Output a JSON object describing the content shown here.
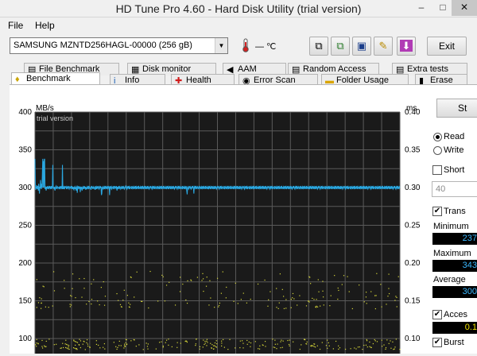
{
  "window": {
    "title": "HD Tune Pro 4.60 - Hard Disk Utility (trial version)",
    "minimize": "–",
    "maximize": "□",
    "close": "✕"
  },
  "menu": {
    "file": "File",
    "help": "Help"
  },
  "toolbar": {
    "drive": "SAMSUNG MZNTD256HAGL-00000 (256 gB)",
    "temperature": "— ℃",
    "exit_label": "Exit",
    "buttons": [
      "copy-info-icon",
      "copy-screenshot-icon",
      "save-icon",
      "options-icon",
      "download-icon"
    ]
  },
  "tabs_row1": [
    "File Benchmark",
    "Disk monitor",
    "AAM",
    "Random Access",
    "Extra tests"
  ],
  "tabs_row2": [
    "Benchmark",
    "Info",
    "Health",
    "Error Scan",
    "Folder Usage",
    "Erase"
  ],
  "side": {
    "start_label": "St",
    "read_label": "Read",
    "write_label": "Write",
    "short_label": "Short",
    "short_value": "40",
    "transfer_label": "Trans",
    "minimum_label": "Minimum",
    "minimum_value": "237",
    "maximum_label": "Maximum",
    "maximum_value": "343",
    "average_label": "Average",
    "average_value": "300",
    "access_label": "Acces",
    "access_value": "0.1",
    "burst_label": "Burst"
  },
  "chart_data": {
    "type": "line",
    "watermark": "trial version",
    "ylabel_left": "MB/s",
    "ylabel_right": "ms",
    "y_left_ticks": [
      400,
      350,
      300,
      250,
      200,
      150,
      100
    ],
    "y_right_ticks": [
      "0.40",
      "0.35",
      "0.30",
      "0.25",
      "0.20",
      "0.15",
      "0.10"
    ],
    "ylim_left": [
      80,
      400
    ],
    "ylim_right": [
      0.08,
      0.4
    ],
    "grid": true,
    "series": [
      {
        "values": [
          338,
          305,
          297,
          301,
          299,
          303,
          298,
          300,
          302,
          296,
          305,
          300,
          292,
          301,
          299,
          310,
          302,
          298,
          305,
          300,
          320,
          338,
          300,
          335,
          300,
          337,
          338,
          298,
          301,
          300,
          296,
          301,
          299,
          300,
          302,
          298,
          300,
          301,
          299,
          300,
          302,
          299,
          300,
          298,
          302,
          300,
          299,
          301,
          330,
          300,
          300,
          298,
          301,
          298,
          296,
          300,
          301,
          302,
          298,
          300,
          299,
          301,
          300,
          300,
          299,
          301,
          298,
          300,
          302,
          299,
          300,
          301,
          299,
          298,
          330,
          298,
          300,
          301,
          298,
          300,
          299,
          302,
          300,
          300,
          301,
          298,
          300,
          299,
          301,
          300,
          302,
          299,
          298,
          300,
          301,
          300,
          299,
          301,
          300,
          302,
          298,
          300,
          299,
          301,
          298,
          297,
          300,
          301,
          298,
          300,
          299,
          296,
          301,
          300,
          293,
          301,
          300,
          299,
          302,
          300,
          298,
          301,
          294,
          300,
          299,
          301,
          298,
          296,
          300,
          301,
          299,
          300,
          298,
          302,
          300,
          299,
          301,
          297,
          300,
          300,
          298,
          301,
          300,
          299,
          302,
          298,
          301,
          300,
          299,
          300,
          300,
          297,
          302,
          299,
          301,
          300,
          298,
          300,
          301,
          299,
          300,
          300,
          297,
          302,
          299,
          300,
          298,
          301,
          300,
          299,
          302,
          300,
          299,
          298,
          301,
          300,
          302,
          299,
          301,
          290,
          292,
          300,
          301,
          299,
          298,
          300,
          301,
          298,
          300,
          302,
          299,
          300,
          301,
          298,
          300,
          299,
          302,
          300,
          301,
          299,
          300,
          290,
          300,
          302,
          299,
          300,
          301,
          298,
          299,
          300,
          301,
          300,
          298,
          302,
          299,
          300,
          301,
          300,
          299,
          302,
          300,
          296,
          301,
          299,
          300,
          298,
          302,
          300,
          299,
          301,
          300,
          298,
          299,
          301,
          300,
          298,
          302,
          300,
          299,
          301,
          300,
          298,
          299,
          301,
          302,
          300,
          299,
          298,
          301,
          300,
          299,
          302,
          300,
          301,
          298,
          300,
          299,
          301,
          300,
          300,
          298,
          302,
          299,
          300,
          301,
          299,
          300,
          298,
          301,
          300,
          299,
          302,
          300,
          298,
          301,
          300,
          299,
          300,
          302,
          298,
          301,
          300,
          299,
          300,
          301,
          298,
          300,
          299,
          302,
          300,
          301,
          298,
          300,
          299,
          301,
          300,
          302,
          298,
          300,
          301,
          299,
          300,
          298,
          302,
          300,
          299,
          301,
          300,
          298,
          299,
          301,
          300,
          302,
          300,
          299,
          298,
          301,
          300,
          299,
          302,
          300,
          301,
          298,
          300,
          299,
          301,
          300,
          300,
          298,
          302,
          299,
          300,
          301,
          299,
          300,
          298,
          301,
          300,
          299,
          302,
          300,
          298,
          301,
          300,
          299,
          300,
          302,
          298,
          301,
          300,
          299,
          300,
          301,
          298,
          300,
          299,
          302,
          300,
          301,
          298,
          300,
          299,
          301,
          300,
          302,
          298,
          300,
          301,
          299,
          300,
          298,
          302,
          300,
          299,
          301,
          300,
          298,
          299,
          301,
          300,
          302,
          300,
          299,
          298,
          301,
          300,
          299,
          302,
          300,
          301,
          298,
          300,
          299,
          301,
          300,
          300,
          298,
          302,
          299,
          300,
          301,
          299,
          300,
          298,
          301,
          300,
          299,
          302,
          300,
          295,
          291,
          300,
          301,
          299,
          298,
          300,
          302,
          300,
          299,
          301,
          300,
          298,
          299,
          301,
          300,
          302,
          300,
          299,
          292,
          301,
          300,
          299,
          302,
          300,
          301,
          298,
          300,
          299,
          301,
          300,
          300,
          298,
          302,
          299,
          300,
          301,
          299,
          300,
          298,
          301,
          300,
          299,
          302,
          300,
          298,
          301,
          300,
          299,
          300,
          302,
          298,
          301,
          300,
          299,
          300,
          301,
          298,
          300,
          299,
          302,
          300,
          301,
          298,
          300,
          299,
          301,
          300,
          302,
          298,
          300,
          301,
          299,
          300,
          298,
          302,
          300,
          299,
          301,
          300,
          298,
          299,
          301,
          300,
          302,
          300,
          299,
          298,
          301,
          300,
          299,
          302,
          300,
          301,
          298,
          300,
          299,
          301,
          300,
          300,
          298,
          302,
          299,
          300,
          301,
          299,
          300,
          298,
          301,
          300,
          299,
          302,
          300,
          298,
          301,
          300,
          299,
          300,
          302,
          298,
          301,
          300,
          299,
          300,
          301,
          298,
          300,
          299,
          302,
          300,
          301,
          298,
          300,
          299,
          301,
          300,
          302,
          298,
          300,
          301,
          299,
          300,
          298,
          302,
          300,
          299,
          301,
          300,
          298,
          299,
          301,
          300,
          302,
          300,
          299,
          298,
          301,
          300,
          299,
          302,
          300,
          301,
          298,
          300,
          299,
          301,
          300,
          300,
          298,
          302,
          299,
          300,
          301,
          299,
          300,
          298,
          301,
          300,
          299,
          302,
          300,
          298,
          301,
          300,
          299,
          300,
          302,
          298,
          301,
          300,
          299,
          300,
          301,
          298,
          300,
          299,
          302,
          300,
          301,
          298,
          300,
          299,
          301,
          300,
          302,
          298,
          300,
          301,
          299,
          300,
          298,
          302,
          300,
          299,
          301,
          300,
          298,
          299,
          301,
          300,
          302,
          300,
          299,
          298,
          301,
          300,
          299,
          302,
          300,
          301,
          298,
          300,
          299,
          301,
          300,
          300,
          298,
          302,
          299,
          300,
          301,
          299,
          300,
          298,
          301,
          300,
          299,
          302,
          300,
          298,
          301,
          300,
          299,
          300,
          302,
          298,
          301,
          300,
          299,
          300,
          301,
          298,
          300,
          299,
          302,
          300,
          301,
          298,
          300,
          299,
          301,
          300,
          302,
          298,
          300,
          301,
          299,
          300,
          298,
          302,
          300,
          299,
          301,
          300,
          298,
          299,
          301,
          300,
          302,
          300,
          299,
          298,
          301,
          300,
          299,
          302,
          300,
          301,
          298,
          300,
          299,
          301,
          300,
          300,
          298,
          302,
          299,
          300,
          301,
          299,
          300,
          298,
          301,
          300,
          299,
          302,
          300,
          298,
          301,
          300,
          299,
          300,
          302,
          298,
          301,
          300,
          299,
          300,
          301,
          298,
          300,
          299,
          302,
          300,
          301,
          298,
          300,
          299,
          301,
          300,
          302,
          298,
          300,
          301,
          299,
          300,
          298,
          302,
          300,
          299,
          301,
          300,
          298,
          299,
          301,
          300,
          302,
          300,
          299,
          298,
          301,
          300,
          299,
          302,
          300,
          301,
          298,
          300,
          299,
          301,
          300,
          300,
          298,
          302,
          299,
          300,
          301,
          299,
          300,
          298,
          301,
          300,
          299,
          302,
          300,
          298,
          301,
          300,
          299,
          300,
          302,
          298,
          301,
          300,
          299,
          300,
          301,
          298,
          300,
          299,
          302,
          300,
          301,
          298,
          300,
          299,
          301,
          300,
          302,
          298,
          300,
          301,
          299,
          300,
          298,
          302,
          300,
          299,
          301,
          300,
          298,
          299,
          301,
          300,
          302,
          300,
          299,
          298,
          301,
          300,
          299,
          302,
          300,
          301,
          298,
          300,
          299,
          301,
          300,
          300,
          298,
          302,
          299,
          300,
          301,
          299,
          300,
          298,
          301,
          300,
          299,
          302,
          300,
          298,
          301,
          300,
          299,
          300,
          302,
          298,
          301,
          300,
          299,
          300,
          301,
          298,
          300,
          299,
          302,
          300,
          301,
          298,
          300,
          299,
          301,
          300,
          302,
          298,
          300,
          301,
          299,
          300,
          298,
          302,
          300,
          299,
          301,
          300,
          298,
          299,
          301,
          300,
          302,
          300,
          299,
          298,
          301,
          300,
          299,
          302,
          300,
          301,
          298,
          300,
          299,
          301,
          300,
          300,
          298,
          302,
          299,
          300,
          301,
          299,
          300,
          298,
          301,
          300,
          299,
          302,
          300,
          298,
          301,
          300,
          299,
          300,
          302,
          298,
          301,
          300,
          299,
          300,
          301,
          298,
          300,
          299,
          302,
          300,
          301,
          298,
          300,
          299,
          301,
          300,
          302,
          298,
          300,
          301,
          299,
          300,
          298,
          302,
          300,
          299,
          301,
          300,
          298,
          299,
          301,
          300,
          302,
          300,
          299,
          298,
          301,
          300,
          299,
          302,
          300,
          301,
          298,
          300,
          299,
          301,
          300
        ],
        "color": "#2aa7e0"
      }
    ],
    "colors": {
      "background": "#1a1a1a",
      "grid": "#5a5a5a",
      "line": "#2aa7e0",
      "access_points": "#d8d83a"
    }
  }
}
